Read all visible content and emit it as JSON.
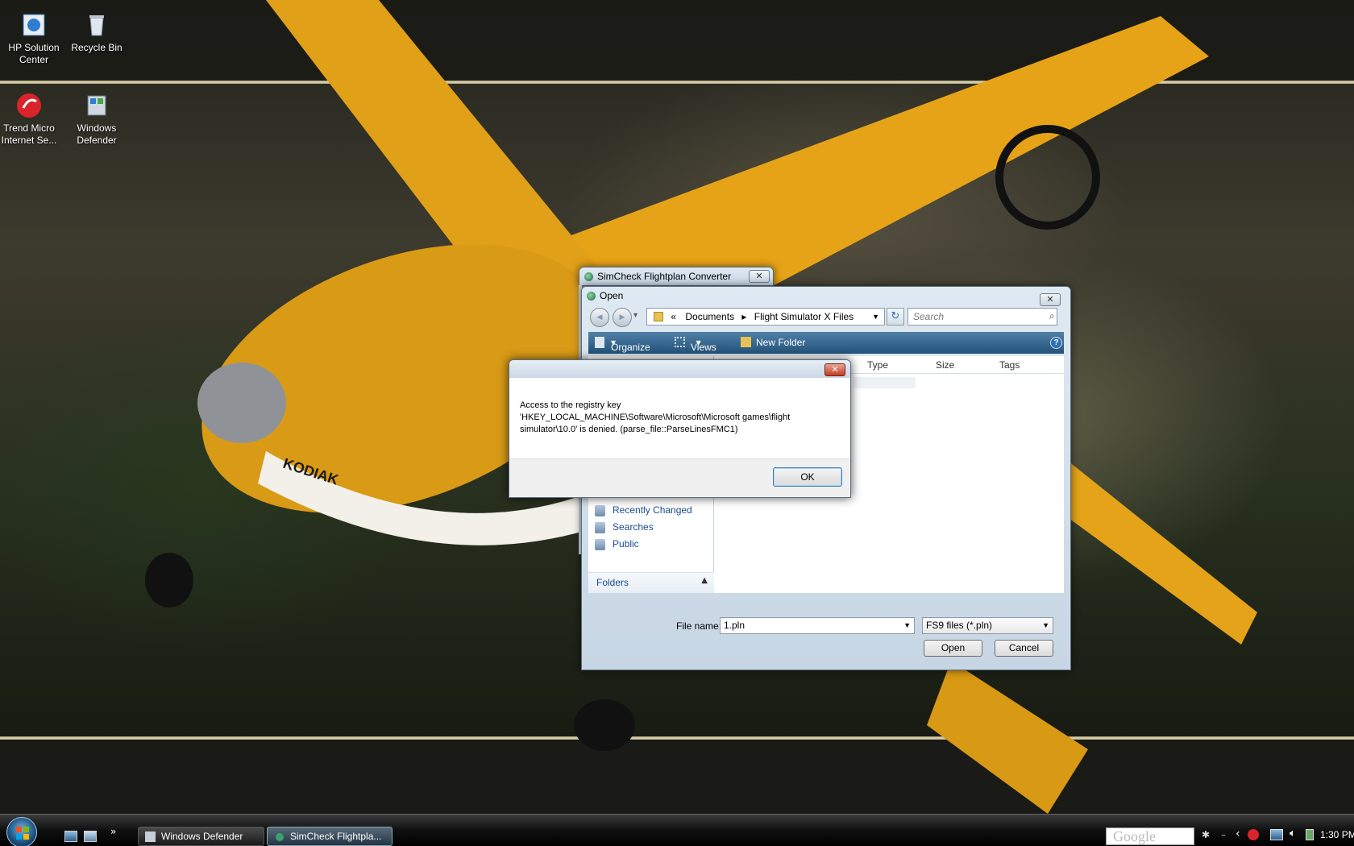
{
  "desktop_icons": [
    {
      "name": "hp-solution-center",
      "line1": "HP Solution",
      "line2": "Center"
    },
    {
      "name": "recycle-bin",
      "line1": "Recycle Bin",
      "line2": ""
    },
    {
      "name": "trend-micro",
      "line1": "Trend Micro",
      "line2": "Internet Se..."
    },
    {
      "name": "windows-defender",
      "line1": "Windows",
      "line2": "Defender"
    }
  ],
  "wallpaper": {
    "plane_text": "KODIAK",
    "accent": "#e6a317"
  },
  "app_window": {
    "title": "SimCheck Flightplan Converter",
    "close": "✕"
  },
  "open_dialog": {
    "title": "Open",
    "close": "✕",
    "back": "◀",
    "forward": "▶",
    "recent": "▾",
    "breadcrumb": [
      "«",
      "Documents",
      "▸",
      "Flight Simulator X Files"
    ],
    "search_placeholder": "Search",
    "toolbar": {
      "organize": "Organize",
      "views": "Views",
      "new_folder": "New Folder",
      "help": "?"
    },
    "columns": [
      "Type",
      "Size",
      "Tags"
    ],
    "nav_links": [
      "Recently Changed",
      "Searches",
      "Public"
    ],
    "folders_label": "Folders",
    "file_name_label": "File name:",
    "file_name_value": "1.pln",
    "file_type_value": "FS9 files (*.pln)",
    "open_label": "Open",
    "cancel_label": "Cancel"
  },
  "error_dialog": {
    "message_line1": "Access to the registry key",
    "message_line2": "'HKEY_LOCAL_MACHINE\\Software\\Microsoft\\Microsoft games\\flight",
    "message_line3": "simulator\\10.0' is denied. (parse_file::ParseLinesFMC1)",
    "ok_label": "OK",
    "close": "✕"
  },
  "taskbar": {
    "items": [
      "Windows Defender",
      "SimCheck Flightpla..."
    ],
    "more": "»",
    "search_text": "Google",
    "time": "1:30 PM"
  }
}
